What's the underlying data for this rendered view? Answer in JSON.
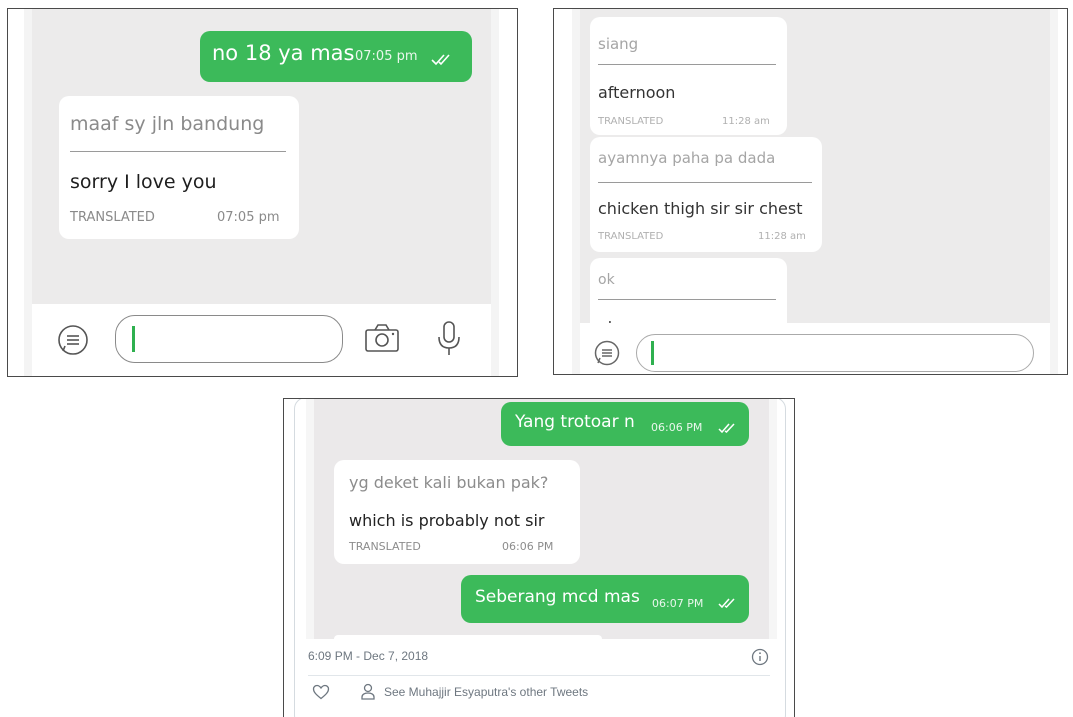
{
  "panel_a": {
    "sent": {
      "text": "no 18 ya mas",
      "time": "07:05 pm"
    },
    "received": {
      "original": "maaf sy jln bandung",
      "translated": "sorry I love you",
      "tag": "TRANSLATED",
      "time": "07:05 pm"
    },
    "input": {
      "value": ""
    }
  },
  "panel_b": {
    "messages": [
      {
        "original": "siang",
        "translated": "afternoon",
        "tag": "TRANSLATED",
        "time": "11:28 am"
      },
      {
        "original": "ayamnya paha pa dada",
        "translated": "chicken thigh sir sir chest",
        "tag": "TRANSLATED",
        "time": "11:28 am"
      },
      {
        "original": "ok",
        "translated": "okay"
      }
    ],
    "input": {
      "value": ""
    }
  },
  "panel_c": {
    "sent_top": {
      "text": "Yang trotoar n",
      "time": "06:06 PM"
    },
    "received": {
      "original": "yg deket kali bukan pak?",
      "translated": "which is probably not sir",
      "tag": "TRANSLATED",
      "time": "06:06 PM"
    },
    "sent_bottom": {
      "text": "Seberang mcd mas",
      "time": "06:07 PM"
    },
    "tweet": {
      "timestamp": "6:09 PM - Dec 7, 2018",
      "other_tweets": "See Muhajjir Esyaputra's other Tweets"
    }
  },
  "colors": {
    "sent_bubble": "#3cba5a",
    "background": "#ecebeb",
    "caret": "#2fb04f"
  },
  "icons": [
    "chat-menu-icon",
    "camera-icon",
    "microphone-icon",
    "double-check-icon",
    "heart-icon",
    "person-icon",
    "info-icon"
  ]
}
